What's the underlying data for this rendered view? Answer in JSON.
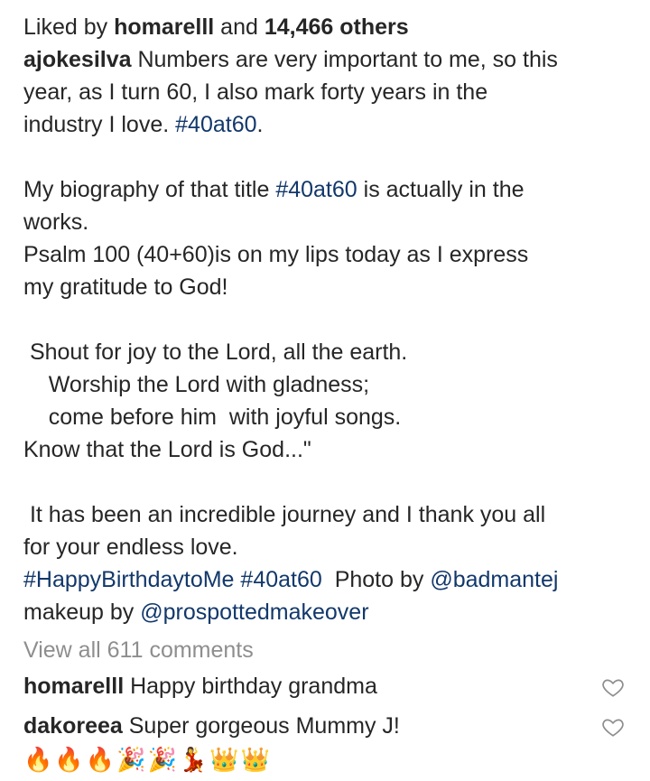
{
  "likes": {
    "prefix": "Liked by ",
    "user": "homarelll",
    "joiner": " and ",
    "count": "14,466 others"
  },
  "caption": {
    "username": "ajokesilva",
    "l1": " Numbers are very important to me, so this",
    "l2": "year, as I turn 60, I also mark forty years in the",
    "l3_text": "industry I love. ",
    "l3_tag": "#40at60",
    "l3_end": ".",
    "l4_text": "My biography of that title ",
    "l4_tag": "#40at60",
    "l4_end": " is actually in the",
    "l5": "works.",
    "l6": "Psalm 100 (40+60)is on my lips today as I express",
    "l7": "my gratitude to God!",
    "l8": " Shout for joy to the Lord, all the earth.",
    "l9": "    Worship the Lord with gladness;",
    "l10": "    come before him  with joyful songs.",
    "l11": "Know that the Lord is God...\"",
    "l12": " It has been an incredible journey and I thank you all",
    "l13": "for your endless love.",
    "l14_tag1": "#HappyBirthdaytoMe",
    "l14_tag2": "#40at60",
    "l14_text": "  Photo by ",
    "l14_mention": "@badmantej",
    "l15_text": "makeup by ",
    "l15_mention": "@prospottedmakeover"
  },
  "view_all": "View all 611 comments",
  "comments": [
    {
      "user": "homarelll",
      "text": " Happy birthday grandma",
      "heart_icon": "heart-outline-icon"
    },
    {
      "user": "dakoreea",
      "text": " Super gorgeous Mummy J!",
      "heart_icon": "heart-outline-icon"
    }
  ],
  "emoji_line": "🔥🔥🔥🎉🎉💃👑👑"
}
